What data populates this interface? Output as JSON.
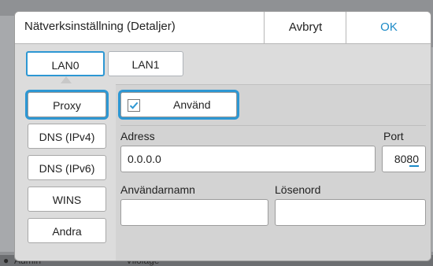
{
  "background": {
    "footer_user": "Admin",
    "footer_status": "Vilolage"
  },
  "dialog": {
    "title": "Nätverksinställning (Detaljer)",
    "cancel_label": "Avbryt",
    "ok_label": "OK"
  },
  "tabs": [
    {
      "label": "LAN0",
      "selected": true
    },
    {
      "label": "LAN1",
      "selected": false
    }
  ],
  "sidebar": {
    "items": [
      {
        "label": "Proxy",
        "selected": true
      },
      {
        "label": "DNS (IPv4)",
        "selected": false
      },
      {
        "label": "DNS (IPv6)",
        "selected": false
      },
      {
        "label": "WINS",
        "selected": false
      },
      {
        "label": "Andra",
        "selected": false
      }
    ]
  },
  "proxy": {
    "use_label": "Använd",
    "use_checked": true,
    "address_label": "Adress",
    "address_value": "0.0.0.0",
    "port_label": "Port",
    "port_value": "8080",
    "username_label": "Användarnamn",
    "username_value": "",
    "password_label": "Lösenord",
    "password_value": ""
  },
  "colors": {
    "accent": "#2d97d3",
    "ok_text": "#1c8ac7"
  }
}
